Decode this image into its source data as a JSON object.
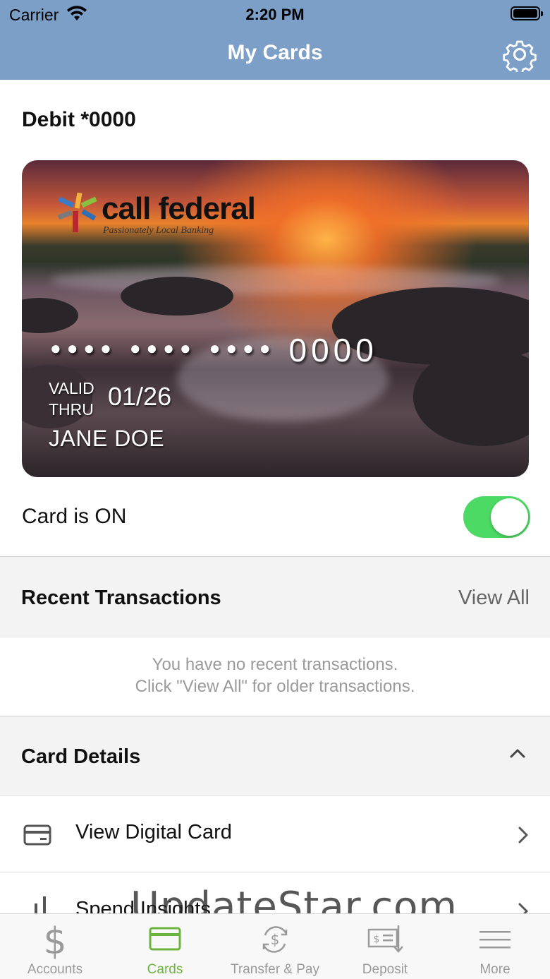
{
  "status_bar": {
    "carrier": "Carrier",
    "time": "2:20 PM"
  },
  "header": {
    "title": "My Cards",
    "settings_icon": "gear-icon"
  },
  "card": {
    "title": "Debit *0000",
    "brand_name": "call federal",
    "brand_tagline": "Passionately Local Banking",
    "masked_groups": [
      "●●●●",
      "●●●●",
      "●●●●"
    ],
    "last_four": "0000",
    "valid_thru_label_1": "VALID",
    "valid_thru_label_2": "THRU",
    "expiry": "01/26",
    "holder": "JANE DOE"
  },
  "card_toggle": {
    "label": "Card is ON",
    "on": true,
    "color": "#4cd964"
  },
  "recent_transactions": {
    "title": "Recent Transactions",
    "view_all": "View All",
    "empty_line_1": "You have no recent transactions.",
    "empty_line_2": "Click \"View All\" for older transactions."
  },
  "card_details": {
    "title": "Card Details",
    "expanded": true,
    "items": [
      {
        "label": "View Digital Card",
        "icon": "credit-card-icon"
      },
      {
        "label": "Spend Insights",
        "icon": "bar-chart-icon"
      }
    ]
  },
  "watermark": "UpdateStar.com",
  "tabbar": {
    "active_color": "#6db33f",
    "tabs": [
      {
        "label": "Accounts",
        "icon": "dollar-icon",
        "active": false
      },
      {
        "label": "Cards",
        "icon": "card-icon",
        "active": true
      },
      {
        "label": "Transfer & Pay",
        "icon": "transfer-icon",
        "active": false
      },
      {
        "label": "Deposit",
        "icon": "check-deposit-icon",
        "active": false
      },
      {
        "label": "More",
        "icon": "menu-icon",
        "active": false
      }
    ]
  },
  "colors": {
    "header": "#7c9fc8",
    "section_bg": "#f3f3f3"
  }
}
